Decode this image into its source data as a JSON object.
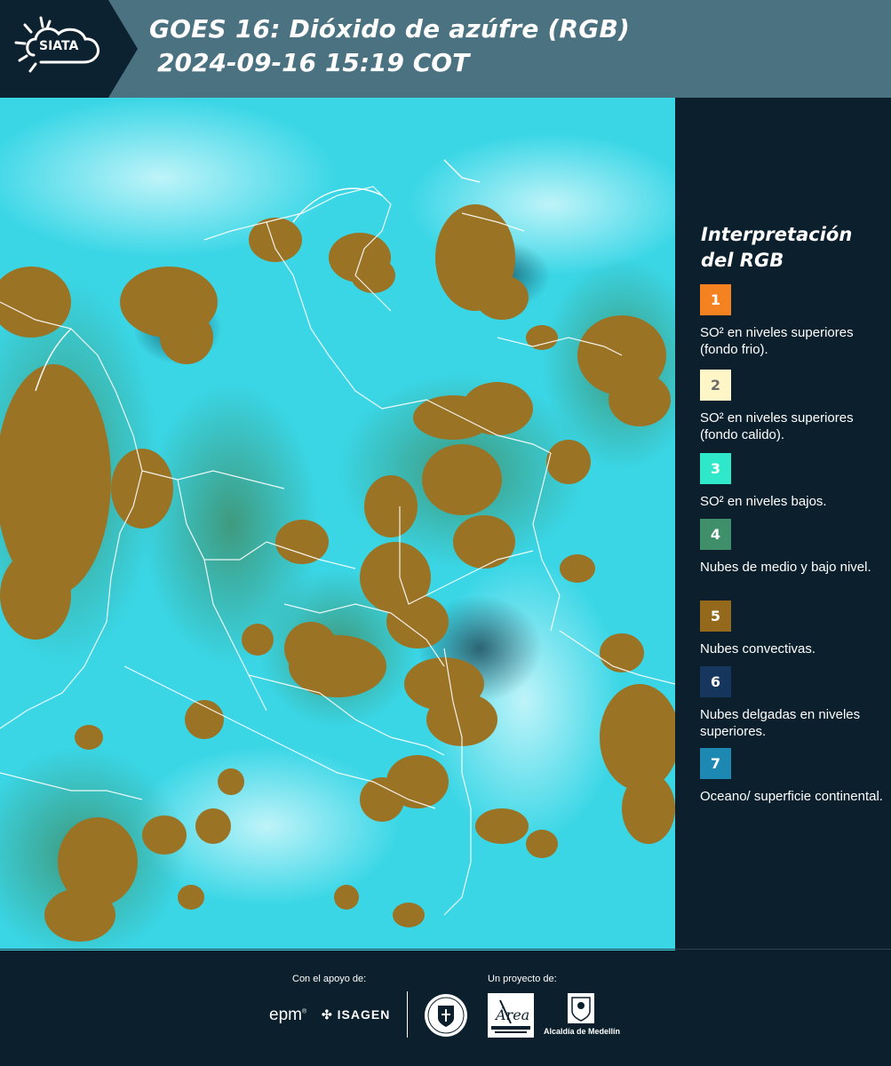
{
  "header": {
    "logo_text": "SIATA",
    "title_line1": "GOES 16: Dióxido de azúfre (RGB)",
    "title_line2": "2024-09-16 15:19 COT"
  },
  "legend": {
    "title": "Interpretación del RGB",
    "items": [
      {
        "number": "1",
        "label": "SO² en niveles superiores (fondo frio).",
        "color": "#f58220",
        "text_color": "#ffffff"
      },
      {
        "number": "2",
        "label": "SO² en niveles superiores (fondo calido).",
        "color": "#fff6c8",
        "text_color": "#6b6b6b"
      },
      {
        "number": "3",
        "label": "SO² en niveles bajos.",
        "color": "#2ee8c9",
        "text_color": "#ffffff"
      },
      {
        "number": "4",
        "label": "Nubes de medio y bajo nivel.",
        "color": "#3f8f6b",
        "text_color": "#ffffff"
      },
      {
        "number": "5",
        "label": "Nubes convectivas.",
        "color": "#94691c",
        "text_color": "#ffffff"
      },
      {
        "number": "6",
        "label": "Nubes delgadas en niveles superiores.",
        "color": "#16365e",
        "text_color": "#ffffff"
      },
      {
        "number": "7",
        "label": "Oceano/ superficie continental.",
        "color": "#1d89b3",
        "text_color": "#ffffff"
      }
    ]
  },
  "footer": {
    "support_label": "Con el apoyo de:",
    "project_label": "Un proyecto de:",
    "epm": "epm",
    "isagen": "ISAGEN",
    "alcaldia": "Alcaldía de Medellín"
  },
  "colors": {
    "map_background": "#3ad6e6",
    "convective_cloud": "#9a7325",
    "low_cloud": "#3f8f6b",
    "header_band": "#4b7281",
    "panel": "#0b1f2c"
  }
}
